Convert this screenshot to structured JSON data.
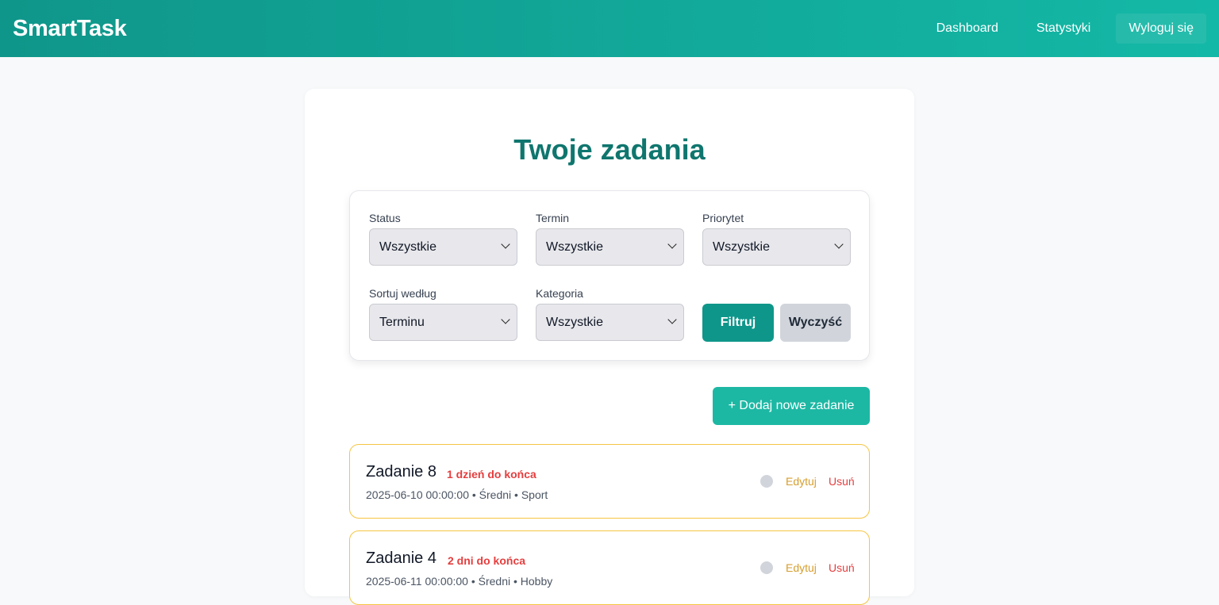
{
  "navbar": {
    "brand": "SmartTask",
    "links": [
      "Dashboard",
      "Statystyki",
      "Wyloguj się"
    ]
  },
  "page": {
    "title": "Twoje zadania"
  },
  "filters": {
    "status": {
      "label": "Status",
      "value": "Wszystkie"
    },
    "termin": {
      "label": "Termin",
      "value": "Wszystkie"
    },
    "priorytet": {
      "label": "Priorytet",
      "value": "Wszystkie"
    },
    "sort": {
      "label": "Sortuj według",
      "value": "Terminu"
    },
    "kategoria": {
      "label": "Kategoria",
      "value": "Wszystkie"
    },
    "filter_button": "Filtruj",
    "clear_button": "Wyczyść"
  },
  "add_button": "+ Dodaj nowe zadanie",
  "tasks": [
    {
      "title": "Zadanie 8",
      "due": "1 dzień do końca",
      "meta": "2025-06-10 00:00:00 • Średni • Sport",
      "edit": "Edytuj",
      "delete": "Usuń"
    },
    {
      "title": "Zadanie 4",
      "due": "2 dni do końca",
      "meta": "2025-06-11 00:00:00 • Średni • Hobby",
      "edit": "Edytuj",
      "delete": "Usuń"
    }
  ],
  "colors": {
    "brand_teal": "#0f968a",
    "title_teal": "#0f766e",
    "add_button": "#1db8a4",
    "due_red": "#e53e3e",
    "edit_amber": "#d69e2e",
    "task_border": "#f5c542"
  }
}
